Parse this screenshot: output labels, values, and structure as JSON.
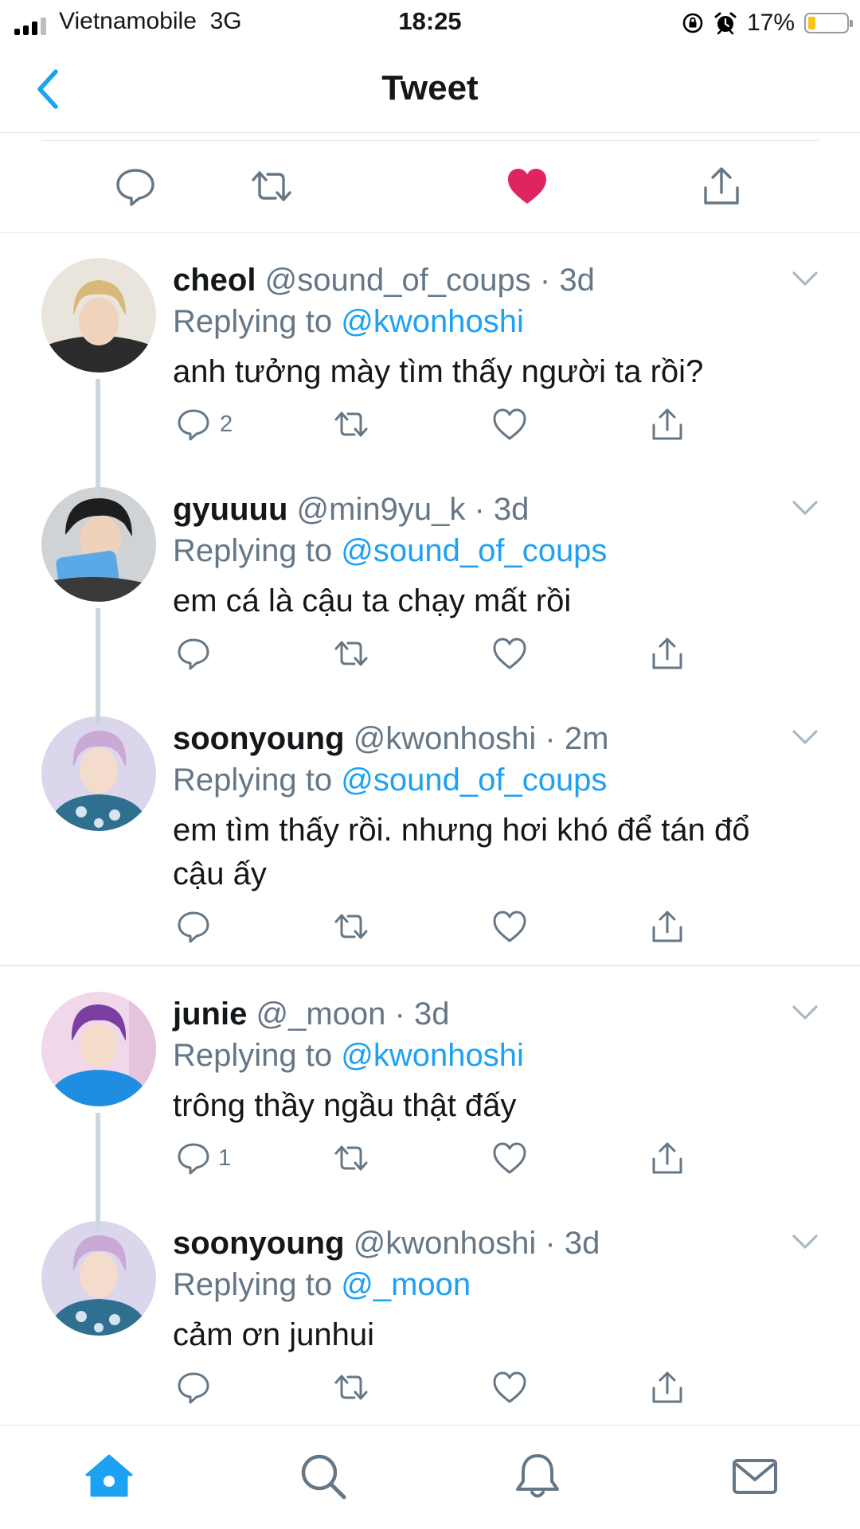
{
  "status_bar": {
    "carrier": "Vietnamobile",
    "network": "3G",
    "time": "18:25",
    "battery": "17%",
    "battery_level": 0.17,
    "battery_color": "#f5c518"
  },
  "header": {
    "back_icon": "chevron-left-icon",
    "title": "Tweet"
  },
  "main_actions": {
    "icons": [
      "reply-icon",
      "retweet-icon",
      "heart-filled-icon",
      "share-icon"
    ],
    "liked_color": "#e0245e"
  },
  "replies": [
    {
      "name": "cheol",
      "handle": "@sound_of_coups",
      "dot": "·",
      "time": "3d",
      "replying_label": "Replying to",
      "replying_to": "@kwonhoshi",
      "text": "anh tưởng mày tìm thấy người ta rồi?",
      "reply_count": "2"
    },
    {
      "name": "gyuuuu",
      "handle": "@min9yu_k",
      "dot": "·",
      "time": "3d",
      "replying_label": "Replying to",
      "replying_to": "@sound_of_coups",
      "text": "em cá là cậu ta chạy mất rồi",
      "reply_count": ""
    },
    {
      "name": "soonyoung",
      "handle": "@kwonhoshi",
      "dot": "·",
      "time": "2m",
      "replying_label": "Replying to",
      "replying_to": "@sound_of_coups",
      "text": "em tìm thấy rồi. nhưng hơi khó để tán đổ cậu ấy",
      "reply_count": ""
    },
    {
      "name": "junie",
      "handle": "@_moon",
      "dot": "·",
      "time": "3d",
      "replying_label": "Replying to",
      "replying_to": "@kwonhoshi",
      "text": "trông thầy ngầu thật đấy",
      "reply_count": "1"
    },
    {
      "name": "soonyoung",
      "handle": "@kwonhoshi",
      "dot": "·",
      "time": "3d",
      "replying_label": "Replying to",
      "replying_to": "@_moon",
      "text": "cảm ơn junhui",
      "reply_count": ""
    }
  ],
  "tab_bar": {
    "tabs": [
      "home-icon",
      "search-icon",
      "notifications-icon",
      "messages-icon"
    ],
    "active": "home-icon",
    "active_color": "#1da1f2",
    "inactive_color": "#657786"
  },
  "colors": {
    "accent": "#1da1f2",
    "secondary_text": "#657786",
    "divider": "#e1e8ed",
    "thread_line": "#ccd6dd"
  }
}
